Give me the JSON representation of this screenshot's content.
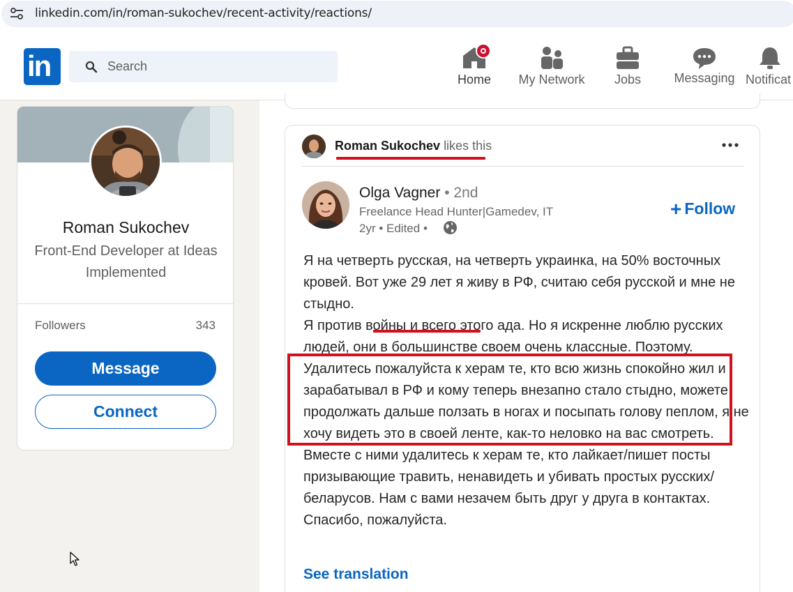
{
  "browser": {
    "url": "linkedin.com/in/roman-sukochev/recent-activity/reactions/"
  },
  "nav": {
    "logo_text": "in",
    "search_placeholder": "Search",
    "items": [
      {
        "label": "Home",
        "icon": "home-icon"
      },
      {
        "label": "My Network",
        "icon": "people-icon"
      },
      {
        "label": "Jobs",
        "icon": "briefcase-icon"
      },
      {
        "label": "Messaging",
        "icon": "chat-icon"
      },
      {
        "label": "Notificat",
        "icon": "bell-icon"
      }
    ]
  },
  "profile": {
    "name": "Roman Sukochev",
    "headline": "Front-End Developer at Ideas Implemented",
    "followers_label": "Followers",
    "followers_count": "343",
    "message_label": "Message",
    "connect_label": "Connect"
  },
  "post": {
    "reactor_name": "Roman Sukochev",
    "reactor_action": "likes this",
    "author_name": "Olga Vagner",
    "author_degree": "• 2nd",
    "author_headline": "Freelance Head Hunter|Gamedev, IT",
    "author_meta": "2yr • Edited •",
    "follow_label": "Follow",
    "body_p1_a": "Я на четверть русская, на четверть украинка, на 50% восточных кровей. Вот уже 29 лет я живу в РФ, считаю себя русской и ",
    "body_p1_b": "мне не стыдно",
    "body_p1_c": ".",
    "body_p2": "Я против войны и всего этого ада. Но я искренне люблю русских людей, они в большинстве своем очень классные. Поэтому. Удалитесь пожалуйста к херам те, кто всю жизнь спокойно жил и зарабатывал в РФ и кому теперь внезапно стало стыдно, можете продолжать дальше ползать в ногах и посыпать голову пеплом, я не хочу видеть это в своей ленте, как-то неловко на вас смотреть. Вместе с ними удалитесь к херам те, кто лайкает/пишет посты призывающие травить, ненавидеть и убивать простых русских/беларусов. Нам с вами незачем быть друг у друга в контактах. Спасибо, пожалуйста.",
    "see_translation": "See translation"
  },
  "colors": {
    "brand": "#0a66c2",
    "annotation_red": "#d0111f",
    "notification_badge": "#cb112d"
  }
}
